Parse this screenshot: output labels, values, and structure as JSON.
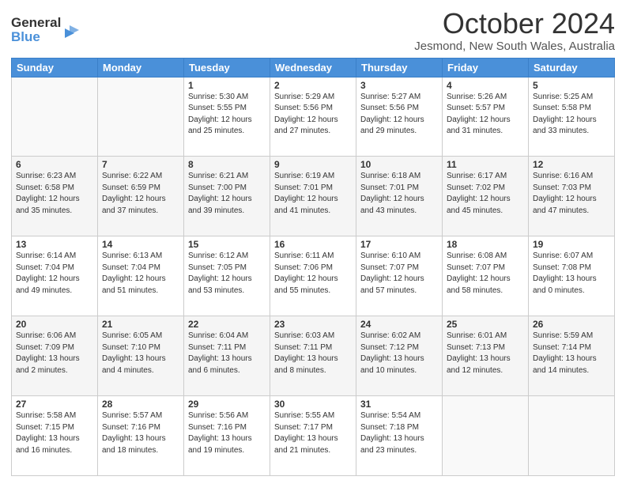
{
  "logo": {
    "line1": "General",
    "line2": "Blue",
    "icon": "▶"
  },
  "title": "October 2024",
  "subtitle": "Jesmond, New South Wales, Australia",
  "header_days": [
    "Sunday",
    "Monday",
    "Tuesday",
    "Wednesday",
    "Thursday",
    "Friday",
    "Saturday"
  ],
  "weeks": [
    [
      {
        "day": "",
        "info": ""
      },
      {
        "day": "",
        "info": ""
      },
      {
        "day": "1",
        "info": "Sunrise: 5:30 AM\nSunset: 5:55 PM\nDaylight: 12 hours\nand 25 minutes."
      },
      {
        "day": "2",
        "info": "Sunrise: 5:29 AM\nSunset: 5:56 PM\nDaylight: 12 hours\nand 27 minutes."
      },
      {
        "day": "3",
        "info": "Sunrise: 5:27 AM\nSunset: 5:56 PM\nDaylight: 12 hours\nand 29 minutes."
      },
      {
        "day": "4",
        "info": "Sunrise: 5:26 AM\nSunset: 5:57 PM\nDaylight: 12 hours\nand 31 minutes."
      },
      {
        "day": "5",
        "info": "Sunrise: 5:25 AM\nSunset: 5:58 PM\nDaylight: 12 hours\nand 33 minutes."
      }
    ],
    [
      {
        "day": "6",
        "info": "Sunrise: 6:23 AM\nSunset: 6:58 PM\nDaylight: 12 hours\nand 35 minutes."
      },
      {
        "day": "7",
        "info": "Sunrise: 6:22 AM\nSunset: 6:59 PM\nDaylight: 12 hours\nand 37 minutes."
      },
      {
        "day": "8",
        "info": "Sunrise: 6:21 AM\nSunset: 7:00 PM\nDaylight: 12 hours\nand 39 minutes."
      },
      {
        "day": "9",
        "info": "Sunrise: 6:19 AM\nSunset: 7:01 PM\nDaylight: 12 hours\nand 41 minutes."
      },
      {
        "day": "10",
        "info": "Sunrise: 6:18 AM\nSunset: 7:01 PM\nDaylight: 12 hours\nand 43 minutes."
      },
      {
        "day": "11",
        "info": "Sunrise: 6:17 AM\nSunset: 7:02 PM\nDaylight: 12 hours\nand 45 minutes."
      },
      {
        "day": "12",
        "info": "Sunrise: 6:16 AM\nSunset: 7:03 PM\nDaylight: 12 hours\nand 47 minutes."
      }
    ],
    [
      {
        "day": "13",
        "info": "Sunrise: 6:14 AM\nSunset: 7:04 PM\nDaylight: 12 hours\nand 49 minutes."
      },
      {
        "day": "14",
        "info": "Sunrise: 6:13 AM\nSunset: 7:04 PM\nDaylight: 12 hours\nand 51 minutes."
      },
      {
        "day": "15",
        "info": "Sunrise: 6:12 AM\nSunset: 7:05 PM\nDaylight: 12 hours\nand 53 minutes."
      },
      {
        "day": "16",
        "info": "Sunrise: 6:11 AM\nSunset: 7:06 PM\nDaylight: 12 hours\nand 55 minutes."
      },
      {
        "day": "17",
        "info": "Sunrise: 6:10 AM\nSunset: 7:07 PM\nDaylight: 12 hours\nand 57 minutes."
      },
      {
        "day": "18",
        "info": "Sunrise: 6:08 AM\nSunset: 7:07 PM\nDaylight: 12 hours\nand 58 minutes."
      },
      {
        "day": "19",
        "info": "Sunrise: 6:07 AM\nSunset: 7:08 PM\nDaylight: 13 hours\nand 0 minutes."
      }
    ],
    [
      {
        "day": "20",
        "info": "Sunrise: 6:06 AM\nSunset: 7:09 PM\nDaylight: 13 hours\nand 2 minutes."
      },
      {
        "day": "21",
        "info": "Sunrise: 6:05 AM\nSunset: 7:10 PM\nDaylight: 13 hours\nand 4 minutes."
      },
      {
        "day": "22",
        "info": "Sunrise: 6:04 AM\nSunset: 7:11 PM\nDaylight: 13 hours\nand 6 minutes."
      },
      {
        "day": "23",
        "info": "Sunrise: 6:03 AM\nSunset: 7:11 PM\nDaylight: 13 hours\nand 8 minutes."
      },
      {
        "day": "24",
        "info": "Sunrise: 6:02 AM\nSunset: 7:12 PM\nDaylight: 13 hours\nand 10 minutes."
      },
      {
        "day": "25",
        "info": "Sunrise: 6:01 AM\nSunset: 7:13 PM\nDaylight: 13 hours\nand 12 minutes."
      },
      {
        "day": "26",
        "info": "Sunrise: 5:59 AM\nSunset: 7:14 PM\nDaylight: 13 hours\nand 14 minutes."
      }
    ],
    [
      {
        "day": "27",
        "info": "Sunrise: 5:58 AM\nSunset: 7:15 PM\nDaylight: 13 hours\nand 16 minutes."
      },
      {
        "day": "28",
        "info": "Sunrise: 5:57 AM\nSunset: 7:16 PM\nDaylight: 13 hours\nand 18 minutes."
      },
      {
        "day": "29",
        "info": "Sunrise: 5:56 AM\nSunset: 7:16 PM\nDaylight: 13 hours\nand 19 minutes."
      },
      {
        "day": "30",
        "info": "Sunrise: 5:55 AM\nSunset: 7:17 PM\nDaylight: 13 hours\nand 21 minutes."
      },
      {
        "day": "31",
        "info": "Sunrise: 5:54 AM\nSunset: 7:18 PM\nDaylight: 13 hours\nand 23 minutes."
      },
      {
        "day": "",
        "info": ""
      },
      {
        "day": "",
        "info": ""
      }
    ]
  ]
}
